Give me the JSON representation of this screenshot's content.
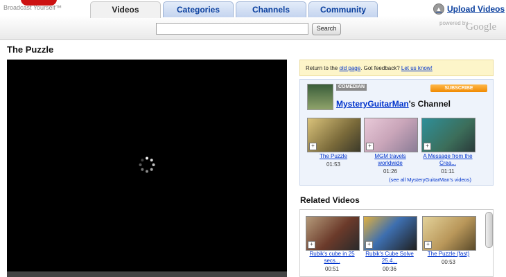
{
  "header": {
    "tagline": "Broadcast Yourself™",
    "tabs": [
      {
        "label": "Videos",
        "active": true
      },
      {
        "label": "Categories",
        "active": false
      },
      {
        "label": "Channels",
        "active": false
      },
      {
        "label": "Community",
        "active": false
      }
    ],
    "upload_label": "Upload Videos",
    "search_placeholder": "",
    "search_button": "Search",
    "powered_by": "powered by",
    "google": "Google"
  },
  "video": {
    "title": "The Puzzle"
  },
  "feedback": {
    "prefix": "Return to the ",
    "old_page": "old page",
    "middle": ".   Got feedback? ",
    "let_us_know": "Let us know!"
  },
  "channel": {
    "badge": "COMEDIAN",
    "subscribe": "SUBSCRIBE",
    "name": "MysteryGuitarMan",
    "suffix": "'s Channel",
    "videos": [
      {
        "title": "The Puzzle",
        "duration": "01:53"
      },
      {
        "title": "MGM travels worldwide",
        "duration": "01:26"
      },
      {
        "title": "A Message from the Crea...",
        "duration": "01:11"
      }
    ],
    "see_all": "(see all MysteryGuitarMan's videos)"
  },
  "related": {
    "heading": "Related Videos",
    "videos": [
      {
        "title": "Rubik's cube in 25 secs...",
        "duration": "00:51"
      },
      {
        "title": "Rubik's Cube Solve 25.4...",
        "duration": "00:36"
      },
      {
        "title": "The Puzzle (fast)",
        "duration": "00:53"
      }
    ]
  },
  "colors": {
    "link": "#0033cc",
    "brand_red": "#cc1111",
    "tab_blue": "#0a3f9e",
    "subscribe_orange": "#f08a00",
    "feedback_bg": "#fdf5c9"
  }
}
